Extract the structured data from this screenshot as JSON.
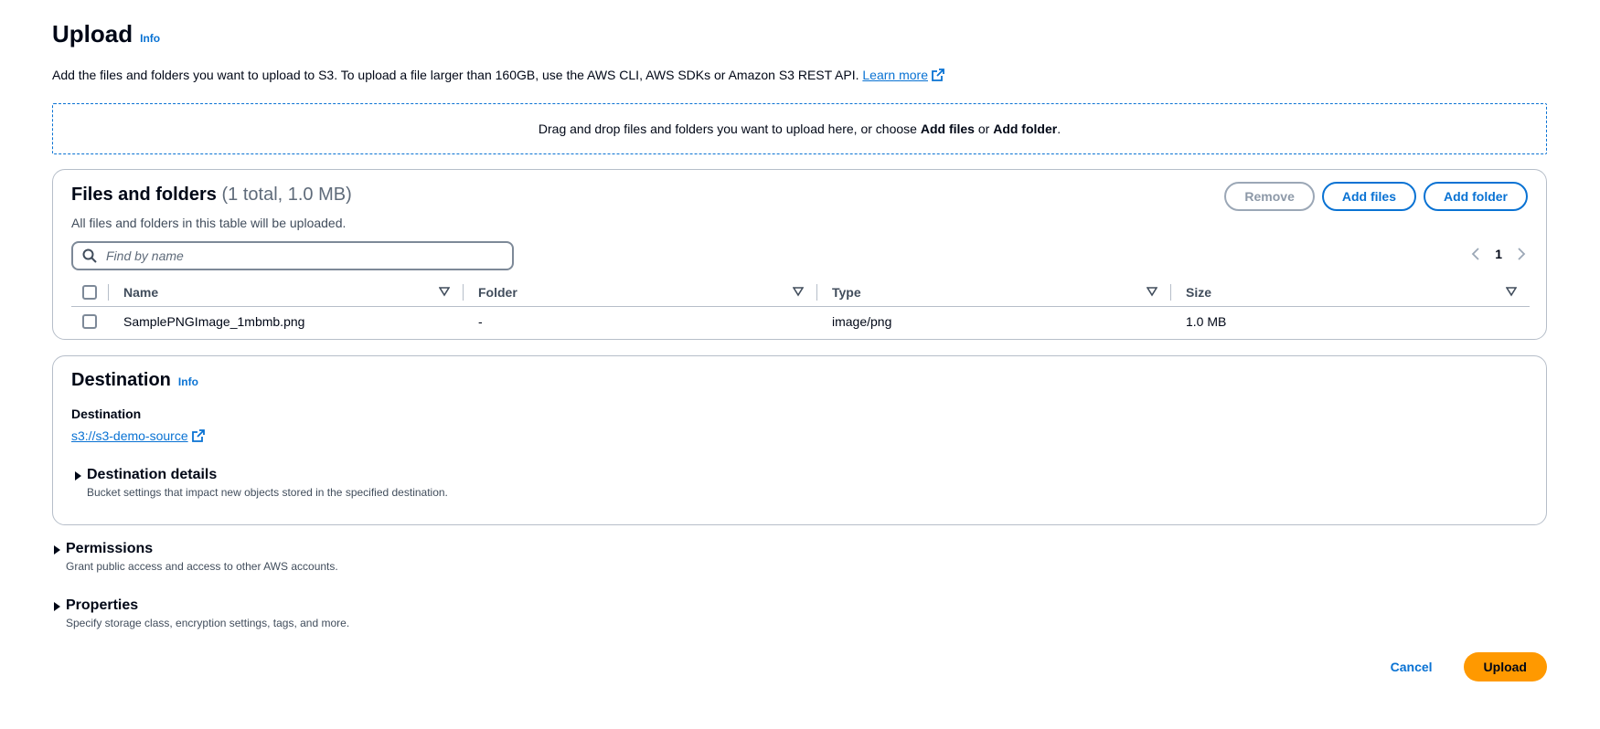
{
  "header": {
    "title": "Upload",
    "info": "Info",
    "description": "Add the files and folders you want to upload to S3. To upload a file larger than 160GB, use the AWS CLI, AWS SDKs or Amazon S3 REST API.",
    "learn_more": "Learn more"
  },
  "dropzone": {
    "text_before": "Drag and drop files and folders you want to upload here, or choose ",
    "add_files": "Add files",
    "or": " or ",
    "add_folder": "Add folder",
    "period": "."
  },
  "files_panel": {
    "title": "Files and folders",
    "count": "(1 total, 1.0 MB)",
    "description": "All files and folders in this table will be uploaded.",
    "remove_label": "Remove",
    "add_files_label": "Add files",
    "add_folder_label": "Add folder",
    "search_placeholder": "Find by name",
    "current_page": "1",
    "columns": [
      "Name",
      "Folder",
      "Type",
      "Size"
    ],
    "rows": [
      {
        "name": "SamplePNGImage_1mbmb.png",
        "folder": "-",
        "type": "image/png",
        "size": "1.0 MB"
      }
    ]
  },
  "destination_panel": {
    "title": "Destination",
    "info": "Info",
    "label": "Destination",
    "link": "s3://s3-demo-source",
    "details_title": "Destination details",
    "details_desc": "Bucket settings that impact new objects stored in the specified destination."
  },
  "permissions": {
    "title": "Permissions",
    "desc": "Grant public access and access to other AWS accounts."
  },
  "properties": {
    "title": "Properties",
    "desc": "Specify storage class, encryption settings, tags, and more."
  },
  "actions": {
    "cancel": "Cancel",
    "upload": "Upload"
  },
  "colors": {
    "link": "#0972d3",
    "primary": "#ff9900",
    "border": "#b6bec9"
  }
}
